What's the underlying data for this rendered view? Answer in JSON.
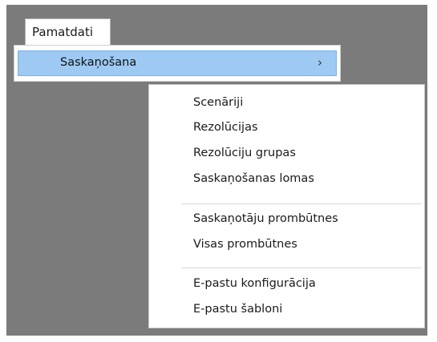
{
  "menubar": {
    "item_label": "Pamatdati"
  },
  "submenu": {
    "item_label": "Saskaņošana",
    "chevron": "›"
  },
  "flyout": {
    "items": [
      "Scenāriji",
      "Rezolūcijas",
      "Rezolūciju grupas",
      "Saskaņošanas lomas",
      "Saskaņotāju prombūtnes",
      "Visas prombūtnes",
      "E-pastu konfigurācija",
      "E-pastu šabloni"
    ]
  },
  "colors": {
    "background_gray": "#7b7b7b",
    "highlight_fill": "#9ec9f3",
    "highlight_border": "#79b1e8"
  }
}
